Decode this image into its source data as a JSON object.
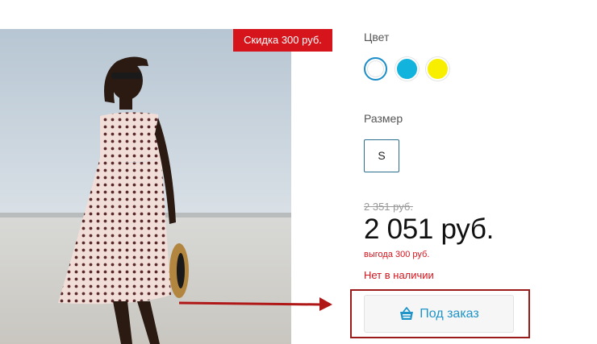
{
  "badge": {
    "discount_label": "Скидка 300 руб."
  },
  "color_section": {
    "label": "Цвет",
    "swatches": [
      {
        "name": "white",
        "color": "#ffffff",
        "selected": true
      },
      {
        "name": "blue",
        "color": "#12b3dd",
        "selected": false
      },
      {
        "name": "yellow",
        "color": "#f8ef00",
        "selected": false
      }
    ]
  },
  "size_section": {
    "label": "Размер",
    "options": [
      "S"
    ]
  },
  "pricing": {
    "old_price": "2 351 руб.",
    "price": "2 051 руб.",
    "saving": "выгода 300 руб.",
    "availability": "Нет в наличии"
  },
  "order": {
    "button_label": "Под заказ",
    "icon": "basket-icon"
  },
  "colors": {
    "accent_red": "#d6141c",
    "accent_blue": "#1e94c9",
    "frame_red": "#9b1b1b"
  }
}
